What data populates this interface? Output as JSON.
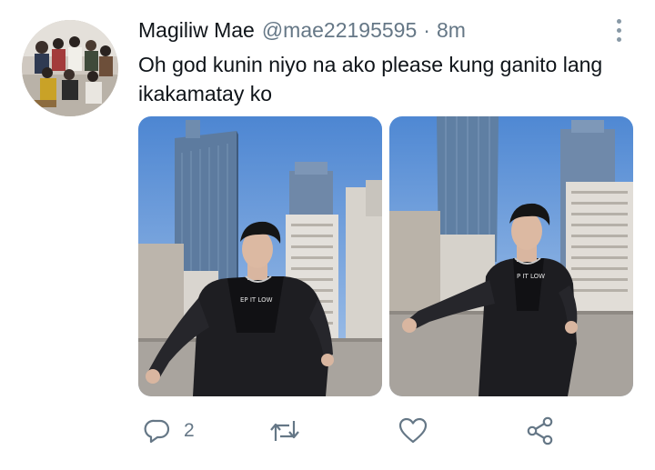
{
  "tweet": {
    "author_name": "Magiliw Mae",
    "handle": "@mae22195595",
    "separator": "·",
    "time": "8m",
    "text": "Oh god kunin niyo na ako please kung ganito lang ikakamatay ko",
    "reply_count": "2",
    "retweet_count": "",
    "like_count": ""
  },
  "icons": {
    "reply": "reply-icon",
    "retweet": "retweet-icon",
    "like": "heart-icon",
    "share": "share-icon",
    "more": "more-options-icon"
  },
  "colors": {
    "text": "#0f1419",
    "secondary": "#657786",
    "sky": "#5f93d6"
  },
  "shirt_lettering": [
    "EP IT LOW",
    "P IT LOW"
  ]
}
